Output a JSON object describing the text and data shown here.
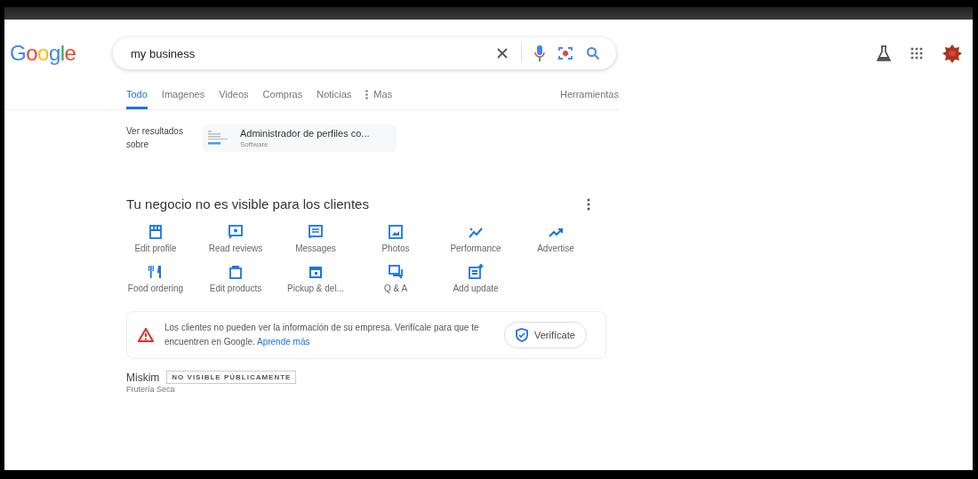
{
  "logo": "Google",
  "search": {
    "value": "my business"
  },
  "tabs": [
    {
      "label": "Todo",
      "selected": true
    },
    {
      "label": "Imagenes",
      "selected": false
    },
    {
      "label": "Videos",
      "selected": false
    },
    {
      "label": "Compras",
      "selected": false
    },
    {
      "label": "Noticias",
      "selected": false
    },
    {
      "label": "Mas",
      "selected": false,
      "kind": "more"
    }
  ],
  "tools": "Herramientas",
  "see_results": {
    "label": "Ver resultados sobre",
    "title": "Administrador de perfiles co...",
    "subtitle": "Software"
  },
  "business_panel": {
    "title": "Tu negocio no es visible para los clientes",
    "actions": [
      {
        "label": "Edit profile"
      },
      {
        "label": "Read reviews"
      },
      {
        "label": "Messages"
      },
      {
        "label": "Photos"
      },
      {
        "label": "Performance"
      },
      {
        "label": "Advertise"
      },
      {
        "label": "Food ordering"
      },
      {
        "label": "Edit products"
      },
      {
        "label": "Pickup & del..."
      },
      {
        "label": "Q & A"
      },
      {
        "label": "Add update"
      }
    ],
    "alert": {
      "text": "Los clientes no pueden ver la información de su empresa. Verifícale para que te encuentren en Google.",
      "link": "Aprende más",
      "button": "Verifícate"
    },
    "name": "Miskim",
    "badge": "NO VISIBLE PÚBLICAMENTE",
    "category": "Frutería Seca"
  }
}
